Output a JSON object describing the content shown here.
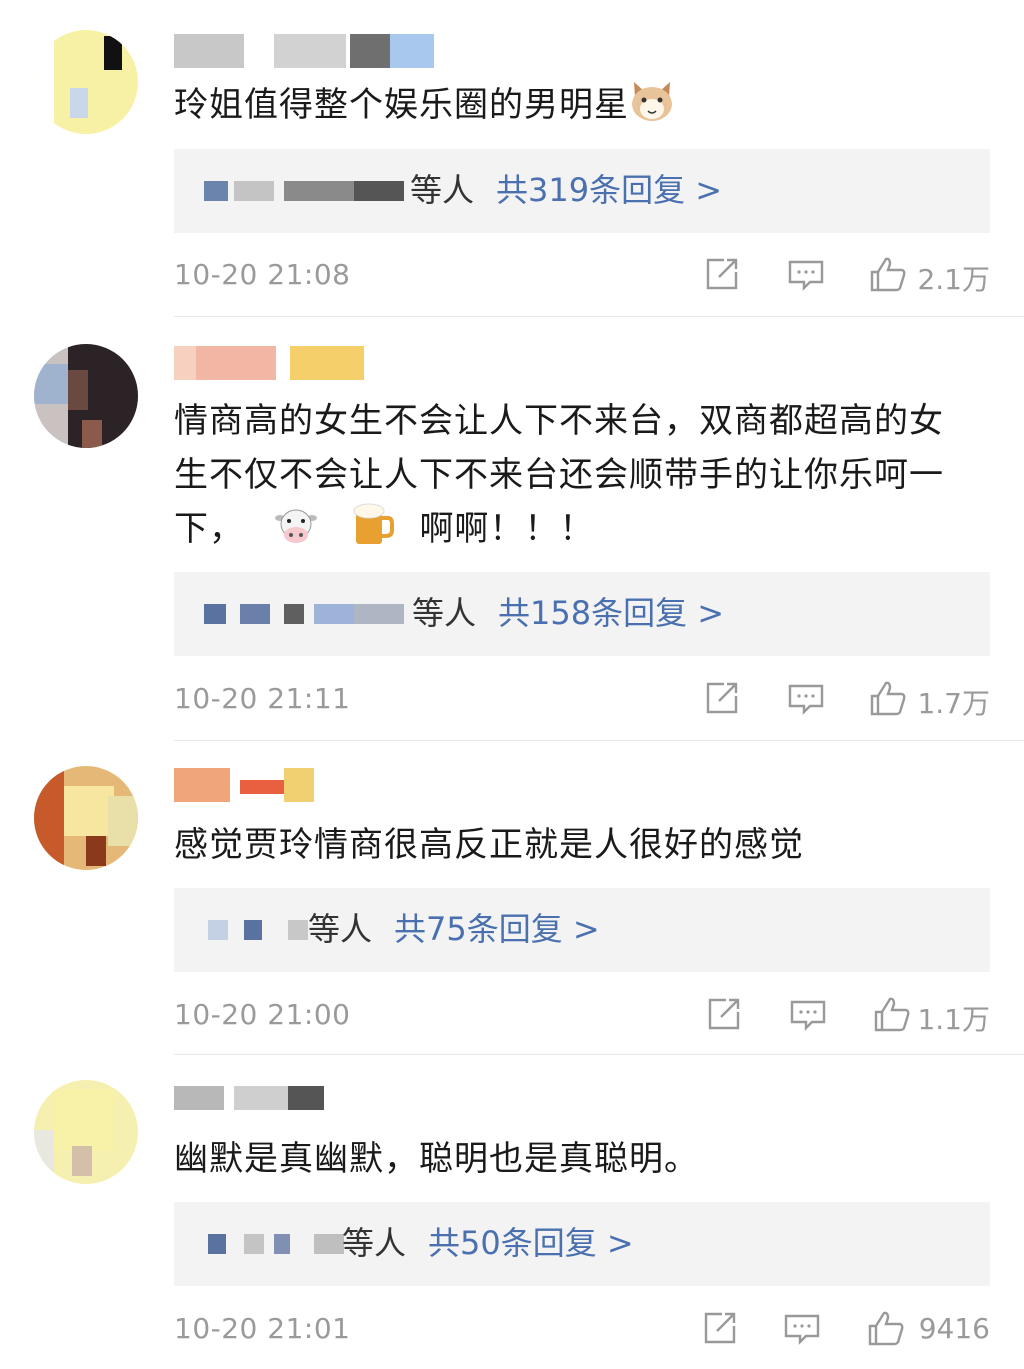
{
  "comments": [
    {
      "text": "玲姐值得整个娱乐圈的男明星",
      "reply_users": "等人",
      "reply_count": "共319条回复 >",
      "time": "10-20 21:08",
      "likes": "2.1万",
      "emoji": "cat-face"
    },
    {
      "text_line1": "情商高的女生不会让人下不来台，双商都超高的女",
      "text_line2": "生不仅不会让人下不来台还会顺带手的让你乐呵一",
      "text_line3_a": "下，",
      "text_line3_b": "啊啊！！！",
      "reply_users": "等人",
      "reply_count": "共158条回复 >",
      "time": "10-20 21:11",
      "likes": "1.7万",
      "emoji": [
        "cow-face",
        "beer-mug"
      ]
    },
    {
      "text": "感觉贾玲情商很高反正就是人很好的感觉",
      "reply_users": "等人",
      "reply_count": "共75条回复 >",
      "time": "10-20 21:00",
      "likes": "1.1万"
    },
    {
      "text": "幽默是真幽默，聪明也是真聪明。",
      "reply_users": "等人",
      "reply_count": "共50条回复 >",
      "time": "10-20 21:01",
      "likes": "9416"
    }
  ],
  "icons": {
    "repost": "share-out-icon",
    "comment": "comment-icon",
    "like": "thumbs-up-icon"
  },
  "colors": {
    "reply_link": "#4a70b0",
    "meta_gray": "#9a9a9a",
    "reply_bg": "#f3f3f3"
  }
}
